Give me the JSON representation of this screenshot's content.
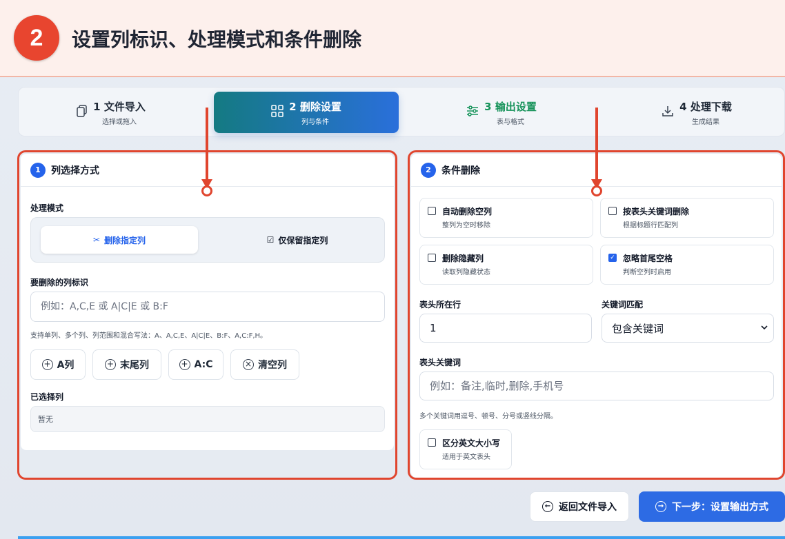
{
  "banner": {
    "step_number": "2",
    "title": "设置列标识、处理模式和条件删除"
  },
  "stepper": [
    {
      "icon": "copy-icon",
      "title": "1 文件导入",
      "sub": "选择或拖入"
    },
    {
      "icon": "grid-icon",
      "title": "2 删除设置",
      "sub": "列与条件"
    },
    {
      "icon": "sliders-icon",
      "title": "3 输出设置",
      "sub": "表与格式"
    },
    {
      "icon": "download-icon",
      "title": "4 处理下载",
      "sub": "生成结果"
    }
  ],
  "left_panel": {
    "number": "1",
    "title": "列选择方式",
    "mode_label": "处理模式",
    "mode_delete": "删除指定列",
    "mode_keep": "仅保留指定列",
    "columns_label": "要删除的列标识",
    "columns_placeholder": "例如：A,C,E 或 A|C|E 或 B:F",
    "columns_hint": "支持单列、多个列、列范围和混合写法：A、A,C,E、A|C|E、B:F、A,C:F,H。",
    "chips": [
      "A列",
      "末尾列",
      "A:C",
      "清空列"
    ],
    "selected_label": "已选择列",
    "selected_value": "暂无"
  },
  "right_panel": {
    "number": "2",
    "title": "条件删除",
    "options": [
      {
        "title": "自动删除空列",
        "sub": "整列为空时移除",
        "checked": false
      },
      {
        "title": "按表头关键词删除",
        "sub": "根据标题行匹配列",
        "checked": false
      },
      {
        "title": "删除隐藏列",
        "sub": "读取列隐藏状态",
        "checked": false
      },
      {
        "title": "忽略首尾空格",
        "sub": "判断空列时启用",
        "checked": true
      }
    ],
    "header_row_label": "表头所在行",
    "header_row_value": "1",
    "keyword_match_label": "关键词匹配",
    "keyword_match_value": "包含关键词",
    "header_keywords_label": "表头关键词",
    "header_keywords_placeholder": "例如：备注,临时,删除,手机号",
    "header_keywords_hint": "多个关键词用逗号、顿号、分号或竖线分隔。",
    "case_option": {
      "title": "区分英文大小写",
      "sub": "适用于英文表头",
      "checked": false
    }
  },
  "footer": {
    "back_label": "返回文件导入",
    "next_label": "下一步：设置输出方式"
  },
  "colors": {
    "accent": "#2563eb",
    "annotation": "#e0452e",
    "done": "#16935a"
  }
}
